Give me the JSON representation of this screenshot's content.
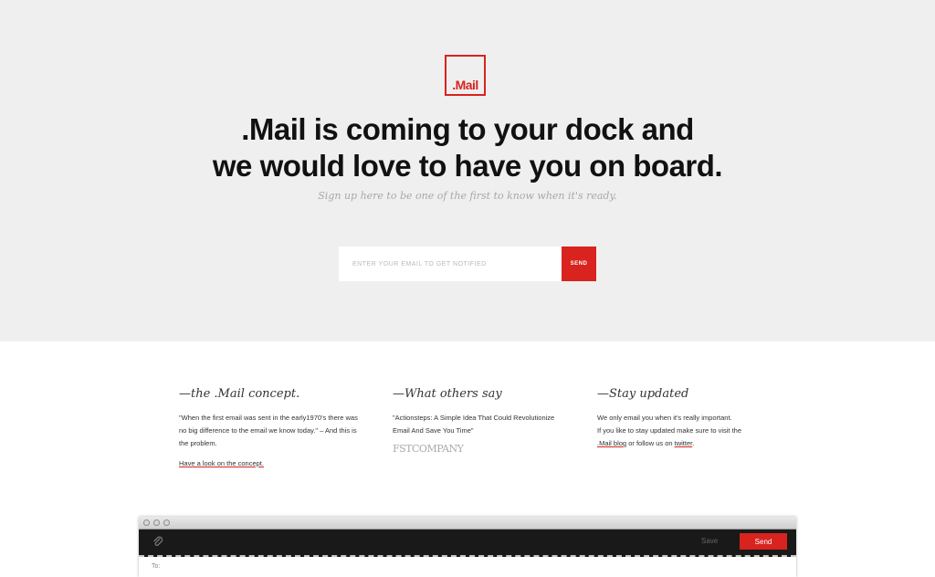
{
  "hero": {
    "logo_text": ".Mail",
    "headline_line1": ".Mail is coming to your dock and",
    "headline_line2": "we would love to have you on board.",
    "subline": "Sign up here to be one of the first to know when it's ready.",
    "email_placeholder": "ENTER YOUR EMAIL TO GET NOTIFIED",
    "email_value": "",
    "send_label": "SEND"
  },
  "columns": {
    "concept": {
      "title": "—the .Mail concept.",
      "text": "\"When the first email was sent in the early1970's there was no big difference to the email we know today.\" –  And this is the problem.",
      "link": "Have a look on the concept."
    },
    "others": {
      "title": "—What others say",
      "quote": "\"Actionsteps: A Simple Idea That Could Revolutionize Email And Save You Time\"",
      "source_logo": "FSTCOMPANY"
    },
    "updated": {
      "title": "—Stay updated",
      "line1": "We only email you when it's really important.",
      "line2": "If you like to stay updated make sure to visit the",
      "blog_link": ".Mail blog",
      "or_text": " or follow us on ",
      "twitter_link": "twitter",
      "period": "."
    }
  },
  "app_window": {
    "save_label": "Save",
    "send_label": "Send",
    "to_label": "To:"
  },
  "colors": {
    "accent": "#d8231f",
    "hero_background": "#efefef",
    "toolbar_background": "#191919"
  },
  "icons": {
    "attachment": "paperclip-icon"
  }
}
